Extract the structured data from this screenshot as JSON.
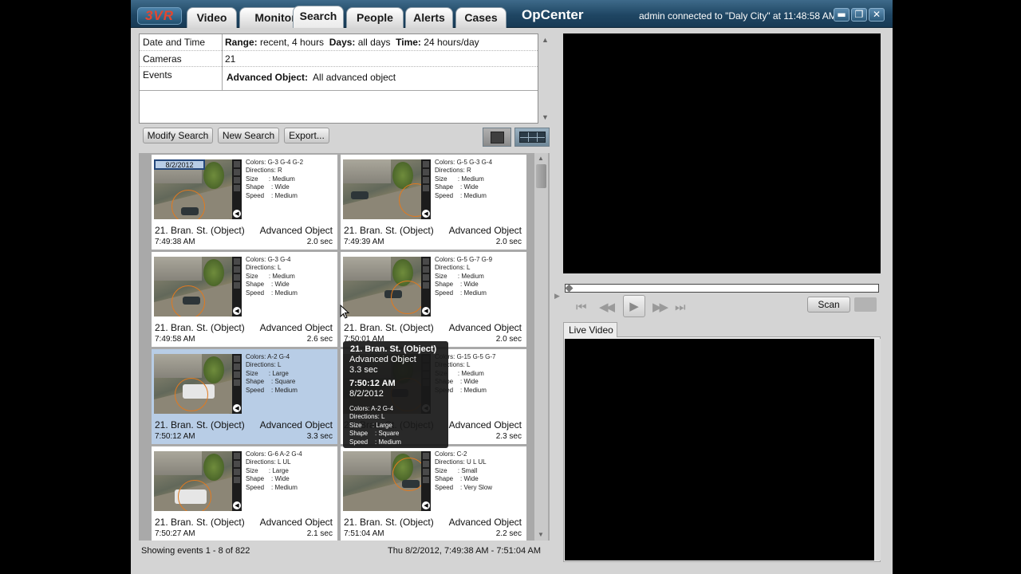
{
  "app": {
    "logo": "3VR",
    "title": "OpCenter",
    "connection": "admin connected to \"Daly City\" at 11:48:58 AM",
    "tabs": [
      "Video",
      "Monitor",
      "Search",
      "People",
      "Alerts",
      "Cases"
    ],
    "active_tab": "Search"
  },
  "criteria": {
    "date_label": "Date and Time",
    "range_label": "Range:",
    "range_value": "recent, 4 hours",
    "days_label": "Days:",
    "days_value": "all days",
    "time_label": "Time:",
    "time_value": "24 hours/day",
    "cameras_label": "Cameras",
    "cameras_value": "21",
    "events_label": "Events",
    "events_type_label": "Advanced Object:",
    "events_type_value": "All advanced object"
  },
  "toolbar": {
    "modify": "Modify Search",
    "new": "New Search",
    "export": "Export..."
  },
  "results": [
    {
      "camera": "21. Bran. St. (Object)",
      "type": "Advanced Object",
      "time": "7:49:38 AM",
      "duration": "2.0 sec",
      "attrs": "Colors: G-3 G-4 G-2\nDirections: R\nSize      : Medium\nShape    : Wide\nSpeed    : Medium",
      "date_badge": "8/2/2012"
    },
    {
      "camera": "21. Bran. St. (Object)",
      "type": "Advanced Object",
      "time": "7:49:39 AM",
      "duration": "2.0 sec",
      "attrs": "Colors: G-5 G-3 G-4\nDirections: R\nSize      : Medium\nShape    : Wide\nSpeed    : Medium"
    },
    {
      "camera": "21. Bran. St. (Object)",
      "type": "Advanced Object",
      "time": "7:49:58 AM",
      "duration": "2.6 sec",
      "attrs": "Colors: G-3 G-4\nDirections: L\nSize      : Medium\nShape    : Wide\nSpeed    : Medium"
    },
    {
      "camera": "21. Bran. St. (Object)",
      "type": "Advanced Object",
      "time": "7:50:01 AM",
      "duration": "2.0 sec",
      "attrs": "Colors: G-5 G-7 G-9\nDirections: L\nSize      : Medium\nShape    : Wide\nSpeed    : Medium"
    },
    {
      "camera": "21. Bran. St. (Object)",
      "type": "Advanced Object",
      "time": "7:50:12 AM",
      "duration": "3.3 sec",
      "attrs": "Colors: A-2 G-4\nDirections: L\nSize      : Large\nShape    : Square\nSpeed    : Medium",
      "selected": true
    },
    {
      "camera": "21. Bran. St. (Object)",
      "type": "Advanced Object",
      "time": "",
      "duration": "2.3 sec",
      "attrs": "Colors: G-15 G-5 G-7\nDirections: L\nSize      : Medium\nShape    : Wide\nSpeed    : Medium"
    },
    {
      "camera": "21. Bran. St. (Object)",
      "type": "Advanced Object",
      "time": "7:50:27 AM",
      "duration": "2.1 sec",
      "attrs": "Colors: G-6 A-2 G-4\nDirections: L UL\nSize      : Large\nShape    : Wide\nSpeed    : Medium"
    },
    {
      "camera": "21. Bran. St. (Object)",
      "type": "Advanced Object",
      "time": "7:51:04 AM",
      "duration": "2.2 sec",
      "attrs": "Colors: C-2\nDirections: U L UL\nSize      : Small\nShape    : Wide\nSpeed    : Very Slow"
    }
  ],
  "tooltip": {
    "camera": "21. Bran. St. (Object)",
    "type": "Advanced Object",
    "duration": "3.3 sec",
    "time": "7:50:12 AM",
    "date": "8/2/2012",
    "attrs": "Colors: A-2 G-4\nDirections: L\nSize      : Large\nShape    : Square\nSpeed    : Medium"
  },
  "status": {
    "left": "Showing events 1 - 8 of 822",
    "right": "Thu 8/2/2012, 7:49:38 AM - 7:51:04 AM"
  },
  "player": {
    "scan": "Scan",
    "live_tab": "Live Video"
  },
  "icons": {
    "skip_start": "⏮",
    "rewind": "◀◀",
    "play": "▶",
    "forward": "▶▶",
    "skip_end": "⏭"
  },
  "colors": {
    "titlebar": "#1f4663",
    "selected_card": "#b8cde6",
    "tooltip_bg": "#191919"
  }
}
